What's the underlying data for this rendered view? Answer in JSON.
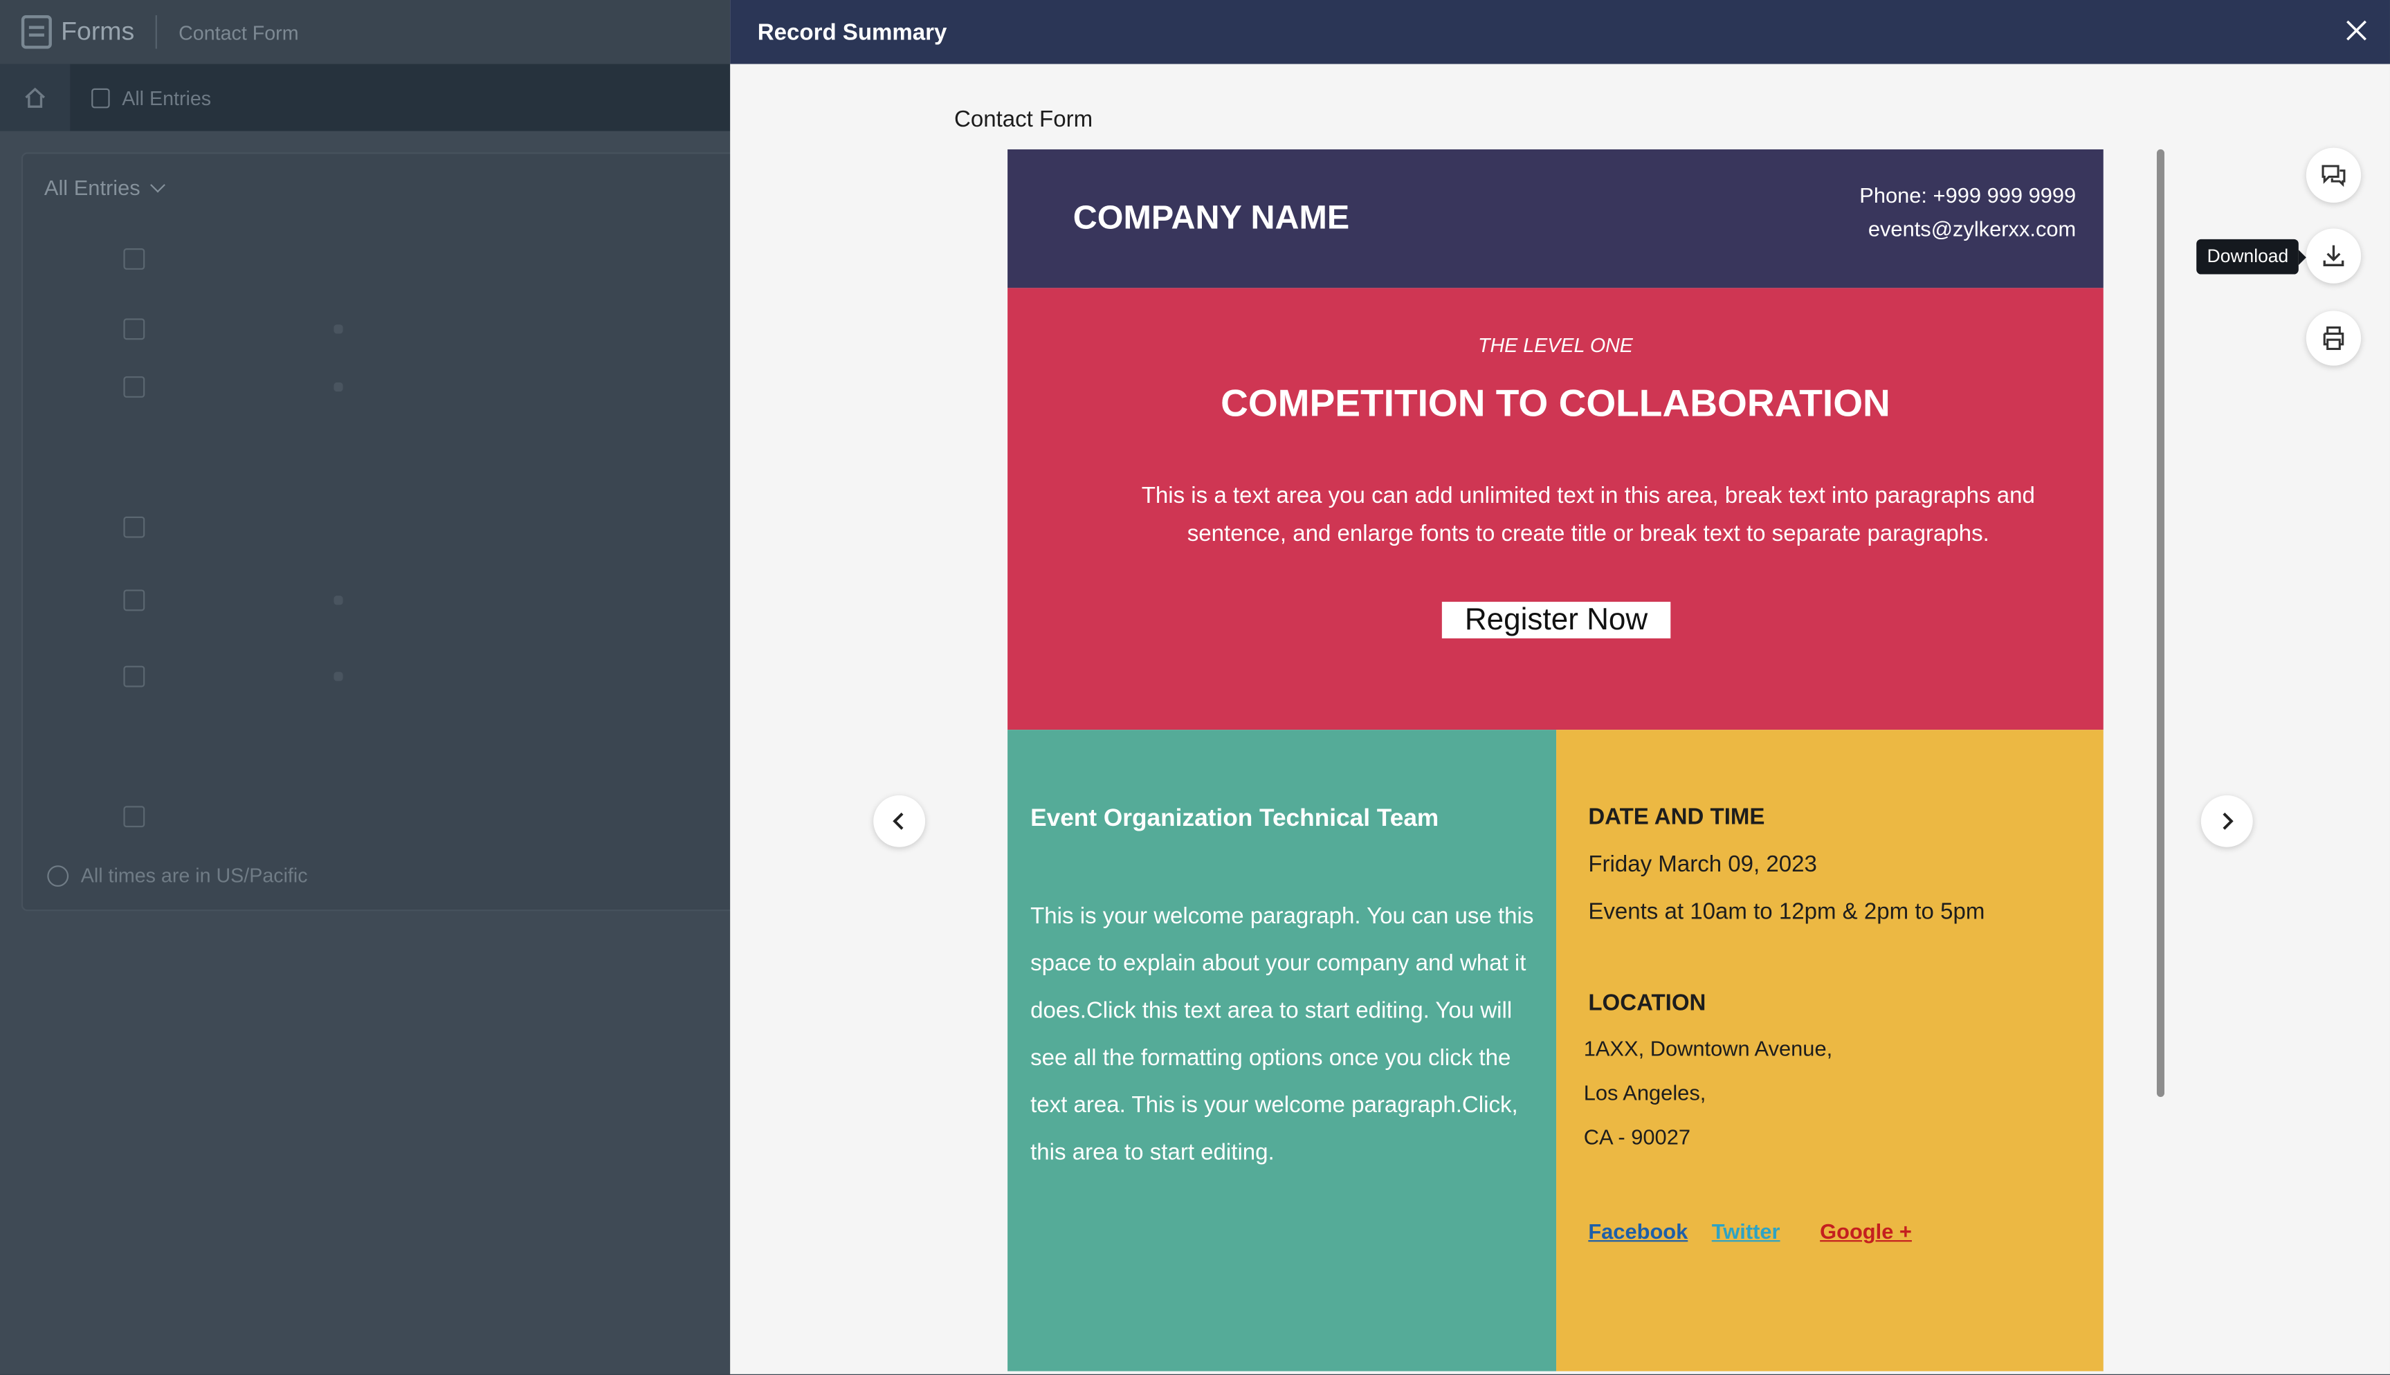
{
  "app": {
    "logo_text": "Forms",
    "form_name": "Contact Form",
    "nav": {
      "all_entries": "All Entries"
    },
    "filter": {
      "label": "All Entries"
    },
    "timezone_note": "All times are in US/Pacific"
  },
  "drawer": {
    "title": "Record Summary",
    "form_label": "Contact Form",
    "tooltip": "Download"
  },
  "preview": {
    "header": {
      "company": "COMPANY NAME",
      "phone": "Phone: +999 999 9999",
      "email": "events@zylkerxx.com"
    },
    "hero": {
      "kicker": "THE LEVEL ONE",
      "headline": "COMPETITION TO COLLABORATION",
      "text": "This is a text area you can add unlimited text in this area, break text into paragraphs and sentence, and enlarge fonts to create title or break text to separate  paragraphs.",
      "button": "Register Now"
    },
    "left": {
      "title": "Event Organization Technical Team",
      "body": "This is your welcome paragraph. You can use this space to explain about your company  and what it does.Click this text area to start editing. You will see all the formatting options once you click the  text area. This is your welcome paragraph.Click, this area to start editing."
    },
    "right": {
      "date_heading": "DATE AND TIME",
      "date": "Friday  March 09, 2023",
      "events": "Events at 10am to 12pm & 2pm to 5pm",
      "location_heading": "LOCATION",
      "address1": "1AXX, Downtown Avenue,",
      "address2": "Los Angeles,",
      "address3": "CA - 90027",
      "social": {
        "facebook": "Facebook ",
        "twitter": "Twitter ",
        "google": "Google + "
      }
    }
  },
  "colors": {
    "drawer_header": "#2b3656",
    "header_band": "#39365c",
    "hero_band": "#cf3653",
    "left_band": "#55ab98",
    "right_band": "#ecb843",
    "facebook": "#1e5fa8",
    "twitter": "#2ea3c4",
    "google": "#c41f1f"
  },
  "icons": {
    "close": "close-icon",
    "prev": "chevron-left-icon",
    "next": "chevron-right-icon",
    "comment": "comment-icon",
    "download": "download-icon",
    "print": "print-icon",
    "home": "home-icon",
    "globe": "globe-icon"
  }
}
